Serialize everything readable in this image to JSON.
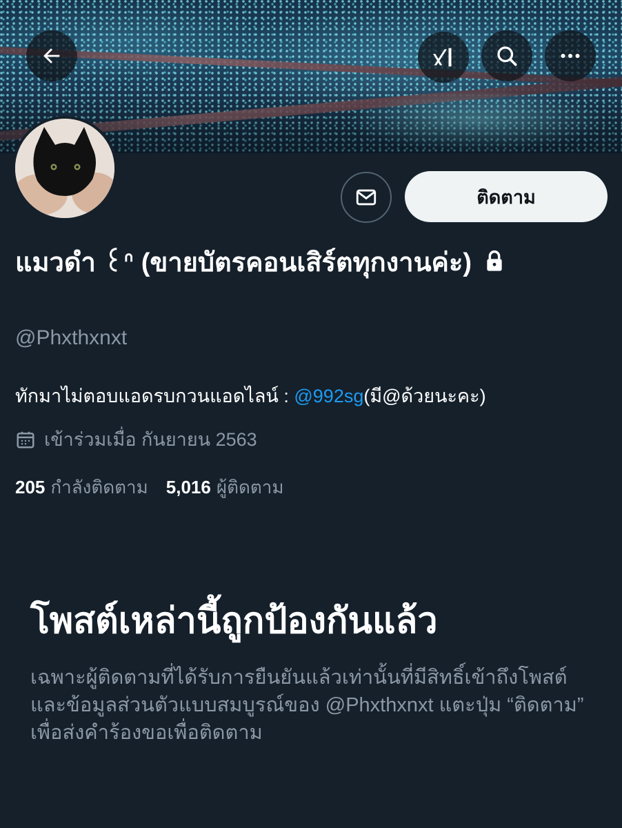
{
  "header": {
    "back_icon": "arrow-left-icon",
    "grok_icon": "grok-icon",
    "search_icon": "search-icon",
    "more_icon": "more-horizontal-icon"
  },
  "profile": {
    "display_name": "แมวดำ ꒰ᐢ (ขายบัตรคอนเสิร์ตทุกงานค่ะ)",
    "handle": "@Phxthxnxt",
    "protected": true,
    "bio_text": "ทักมาไม่ตอบแอดรบกวนแอดไลน์ : ",
    "bio_mention": "@992sg",
    "bio_suffix": "(มี@ด้วยนะคะ)",
    "joined": "เข้าร่วมเมื่อ กันยายน 2563",
    "following_count": "205",
    "following_label": "กำลังติดตาม",
    "followers_count": "5,016",
    "followers_label": "ผู้ติดตาม"
  },
  "actions": {
    "message_icon": "envelope-icon",
    "follow_label": "ติดตาม"
  },
  "protected_notice": {
    "title": "โพสต์เหล่านี้ถูกป้องกันแล้ว",
    "body": "เฉพาะผู้ติดตามที่ได้รับการยืนยันแล้วเท่านั้นที่มีสิทธิ์เข้าถึงโพสต์และข้อมูลส่วนตัวแบบสมบูรณ์ของ @Phxthxnxt แตะปุ่ม “ติดตาม” เพื่อส่งคำร้องขอเพื่อติดตาม"
  },
  "colors": {
    "background": "#15202b",
    "accent": "#1d9bf0",
    "secondary_text": "#8b98a5",
    "follow_button": "#eff3f4"
  }
}
